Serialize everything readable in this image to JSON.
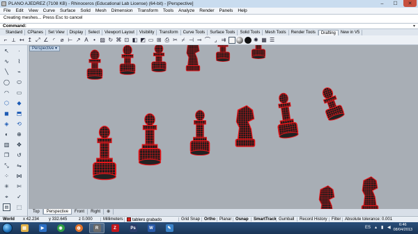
{
  "window": {
    "title": "PLANO AJEDREZ (7108 KB) - Rhinoceros (Educational Lab License) (64-bit) - [Perspective]",
    "controls": [
      "–",
      "☐",
      "✕"
    ]
  },
  "menu": [
    "File",
    "Edit",
    "View",
    "Curve",
    "Surface",
    "Solid",
    "Mesh",
    "Dimension",
    "Transform",
    "Tools",
    "Analyze",
    "Render",
    "Panels",
    "Help"
  ],
  "command": {
    "history": "Creating meshes... Press Esc to cancel",
    "prompt_label": "Command:"
  },
  "toolbar_tabs": [
    "Standard",
    "CPlanes",
    "Set View",
    "Display",
    "Select",
    "Viewport Layout",
    "Visibility",
    "Transform",
    "Curve Tools",
    "Surface Tools",
    "Solid Tools",
    "Mesh Tools",
    "Render Tools",
    "Drafting",
    "New in V5"
  ],
  "active_toolbar_tab": "Drafting",
  "viewport": {
    "name": "Perspective",
    "background": "#a8aeb5",
    "mesh_color": "#e8161b"
  },
  "view_tabs": [
    "Top",
    "Perspective",
    "Front",
    "Right"
  ],
  "active_view_tab": "Perspective",
  "statusbar": {
    "cplane": "World",
    "x": "x 42.234",
    "y": "y 332.645",
    "z": "z 0.000",
    "units": "Millimeters",
    "layer": "tablero grabado",
    "grid_snap": "Grid Snap",
    "ortho": "Ortho",
    "planar": "Planar",
    "osnap": "Osnap",
    "smarttrack": "SmartTrack",
    "gumball": "Gumball",
    "record_history": "Record History",
    "filter": "Filter",
    "tolerance": "Absolute tolerance: 0.001"
  },
  "taskbar": {
    "language": "ES",
    "time": "6:46",
    "date": "08/04/2013",
    "apps": [
      {
        "name": "explorer",
        "glyph": "▤",
        "color": "#e2b34a"
      },
      {
        "name": "media-player",
        "glyph": "▶",
        "color": "#2c6fc4"
      },
      {
        "name": "chrome",
        "glyph": "◉",
        "color": "#2f9e44"
      },
      {
        "name": "firefox",
        "glyph": "◍",
        "color": "#e0722a"
      },
      {
        "name": "rhino",
        "glyph": "R",
        "color": "#6b6b6b"
      },
      {
        "name": "filezilla",
        "glyph": "Z",
        "color": "#c0161b"
      },
      {
        "name": "photoshop",
        "glyph": "Ps",
        "color": "#2b3d6a"
      },
      {
        "name": "word",
        "glyph": "W",
        "color": "#2859a8"
      },
      {
        "name": "paint",
        "glyph": "✎",
        "color": "#3b83c9"
      }
    ]
  }
}
